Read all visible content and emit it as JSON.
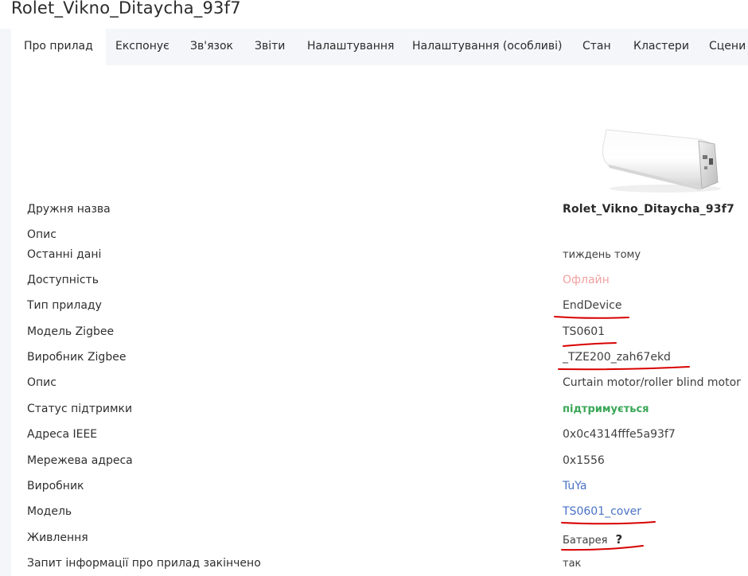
{
  "page": {
    "title": "Rolet_Vikno_Ditaycha_93f7"
  },
  "tabs": [
    {
      "label": "Про прилад",
      "active": true
    },
    {
      "label": "Експонує"
    },
    {
      "label": "Зв'язок"
    },
    {
      "label": "Звіти"
    },
    {
      "label": "Налаштування"
    },
    {
      "label": "Налаштування (особливі)"
    },
    {
      "label": "Стан"
    },
    {
      "label": "Кластери"
    },
    {
      "label": "Сцени"
    }
  ],
  "device_image": {
    "icon": "roller-blind-motor-image"
  },
  "rows": [
    {
      "label": "Дружня назва",
      "value": "Rolet_Vikno_Ditaycha_93f7"
    },
    {
      "label": "Опис",
      "value": ""
    },
    {
      "label": "Останні дані",
      "value": "тиждень тому"
    },
    {
      "label": "Доступність",
      "value": "Офлайн"
    },
    {
      "label": "Тип приладу",
      "value": "EndDevice"
    },
    {
      "label": "Модель Zigbee",
      "value": "TS0601"
    },
    {
      "label": "Виробник Zigbee",
      "value": "_TZE200_zah67ekd"
    },
    {
      "label": "Опис",
      "value": "Curtain motor/roller blind motor"
    },
    {
      "label": "Статус підтримки",
      "value": "підтримується"
    },
    {
      "label": "Адреса IEEE",
      "value": "0x0c4314fffe5a93f7"
    },
    {
      "label": "Мережева адреса",
      "value": "0x1556"
    },
    {
      "label": "Виробник",
      "value": "TuYa"
    },
    {
      "label": "Модель",
      "value": "TS0601_cover"
    },
    {
      "label": "Живлення",
      "value": "Батарея",
      "note": "?"
    },
    {
      "label": "Запит інформації про прилад закінчено",
      "value": "так"
    }
  ],
  "colors": {
    "offline": "#f0a0a0",
    "supported": "#3aa757",
    "link": "#4a72c4",
    "annotation": "#d80000",
    "tab_bar": "#f4f6fa"
  }
}
